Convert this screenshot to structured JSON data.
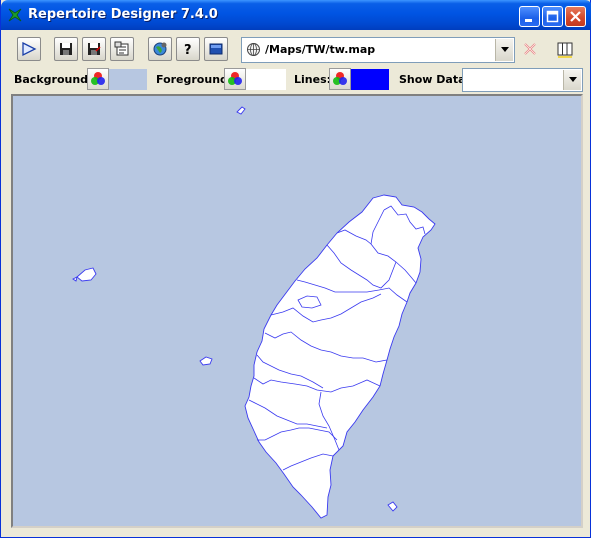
{
  "window": {
    "title": "Repertoire Designer 7.4.0",
    "controls": [
      "minimize",
      "maximize",
      "close"
    ]
  },
  "toolbar": {
    "buttons": [
      {
        "name": "run-icon",
        "tooltip": ""
      },
      {
        "name": "save-icon",
        "tooltip": ""
      },
      {
        "name": "save-as-icon",
        "tooltip": ""
      },
      {
        "name": "properties-icon",
        "tooltip": ""
      },
      {
        "name": "globe-settings-icon",
        "tooltip": ""
      },
      {
        "name": "help-icon",
        "tooltip": ""
      },
      {
        "name": "window-icon",
        "tooltip": ""
      }
    ],
    "map_path": "/Maps/TW/tw.map",
    "right_icons": [
      "delete-icon",
      "columns-icon"
    ]
  },
  "properties": {
    "background_label": "Background:",
    "background_color": "#b7c7e1",
    "foreground_label": "Foreground:",
    "foreground_color": "#ffffff",
    "lines_label": "Lines:",
    "lines_color": "#0000ff",
    "show_data_label": "Show Data:",
    "show_data_value": ""
  },
  "map": {
    "background": "#b7c7e1",
    "land_fill": "#ffffff",
    "border_color": "#3a3af0"
  }
}
